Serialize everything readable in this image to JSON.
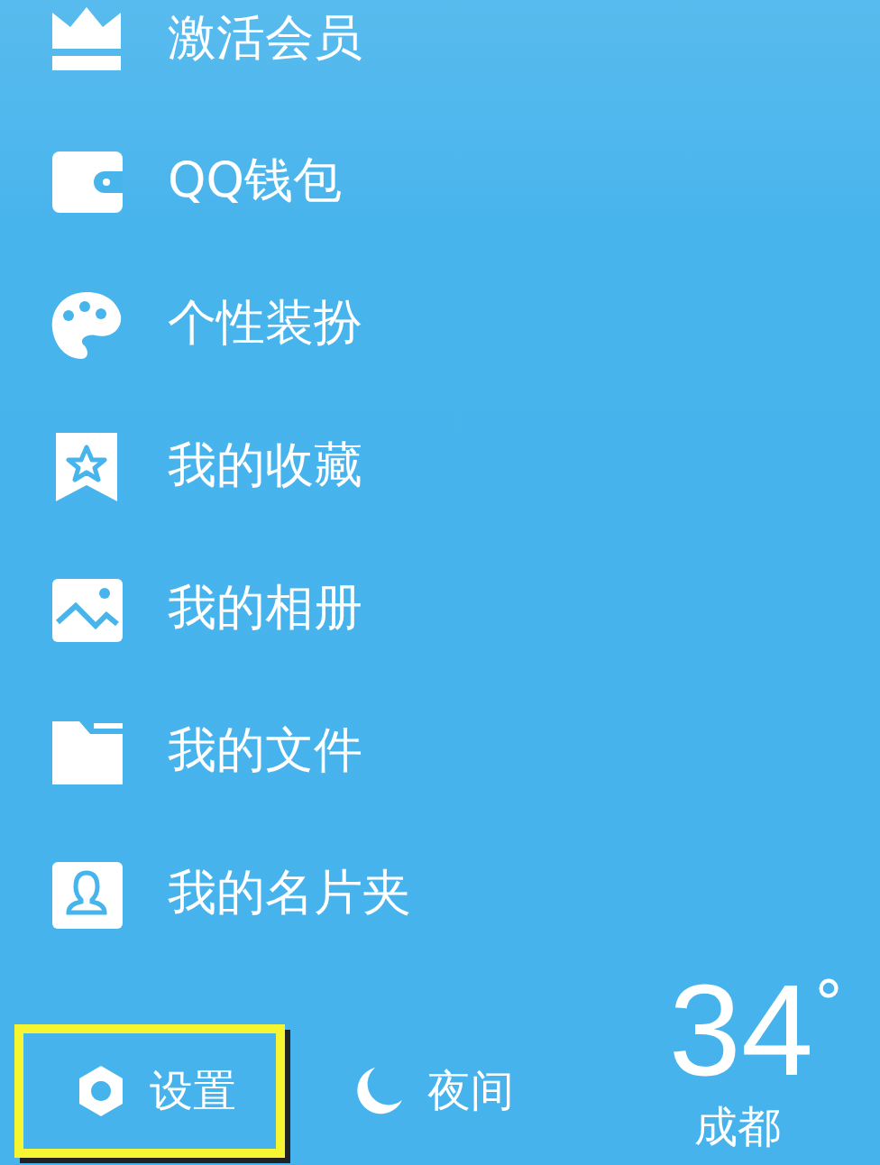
{
  "menu": [
    {
      "label": "激活会员"
    },
    {
      "label": "QQ钱包"
    },
    {
      "label": "个性装扮"
    },
    {
      "label": "我的收藏"
    },
    {
      "label": "我的相册"
    },
    {
      "label": "我的文件"
    },
    {
      "label": "我的名片夹"
    }
  ],
  "footer": {
    "buttons": [
      {
        "kind": "settings",
        "label": "设置",
        "highlighted": true
      },
      {
        "kind": "night",
        "label": "夜间",
        "highlighted": false
      }
    ],
    "weather": {
      "temperature": "34",
      "unit": "°",
      "city": "成都"
    }
  }
}
